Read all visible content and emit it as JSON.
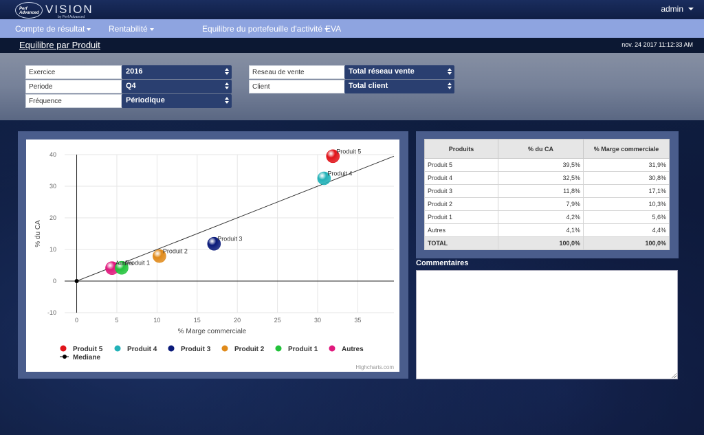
{
  "header": {
    "logo_small": "Perf Advanced",
    "logo_name": "VISION",
    "logo_by": "by Perf Advanced",
    "user": "admin"
  },
  "nav": {
    "items": [
      {
        "label": "Compte de résultat"
      },
      {
        "label": "Rentabilité"
      },
      {
        "label": "Equilibre du portefeuille d'activité"
      },
      {
        "label": "EVA"
      }
    ]
  },
  "page": {
    "title": "Equilibre par Produit",
    "timestamp": "nov. 24 2017 11:12:33 AM"
  },
  "filters": {
    "exercice": {
      "label": "Exercice",
      "value": "2016"
    },
    "periode": {
      "label": "Periode",
      "value": "Q4"
    },
    "frequence": {
      "label": "Fréquence",
      "value": "Périodique"
    },
    "reseau": {
      "label": "Reseau de vente",
      "value": "Total réseau vente"
    },
    "client": {
      "label": "Client",
      "value": "Total client"
    }
  },
  "chart_data": {
    "type": "scatter",
    "xlabel": "% Marge commerciale",
    "ylabel": "% du CA",
    "xlim": [
      -1.5,
      39.5
    ],
    "ylim": [
      -10,
      40
    ],
    "xticks": [
      0,
      5,
      10,
      15,
      20,
      25,
      30,
      35
    ],
    "yticks": [
      -10,
      0,
      10,
      20,
      30,
      40
    ],
    "credit": "Highcharts.com",
    "series": [
      {
        "name": "Produit 5",
        "x": 31.9,
        "y": 39.5,
        "color": "#e0141a"
      },
      {
        "name": "Produit 4",
        "x": 30.8,
        "y": 32.5,
        "color": "#23b2b8"
      },
      {
        "name": "Produit 3",
        "x": 17.1,
        "y": 11.8,
        "color": "#0a1a7a"
      },
      {
        "name": "Produit 2",
        "x": 10.3,
        "y": 7.9,
        "color": "#e08a1a"
      },
      {
        "name": "Produit 1",
        "x": 5.6,
        "y": 4.2,
        "color": "#22c23a"
      },
      {
        "name": "Autres",
        "x": 4.4,
        "y": 4.1,
        "color": "#e0197d"
      }
    ],
    "mediane": {
      "name": "Mediane",
      "points": [
        [
          0,
          0
        ],
        [
          39.5,
          39.5
        ]
      ],
      "color": "#000000"
    },
    "legend_position": "bottom-left"
  },
  "table": {
    "headers": [
      "Produits",
      "% du CA",
      "% Marge commerciale"
    ],
    "rows": [
      [
        "Produit 5",
        "39,5%",
        "31,9%"
      ],
      [
        "Produit 4",
        "32,5%",
        "30,8%"
      ],
      [
        "Produit 3",
        "11,8%",
        "17,1%"
      ],
      [
        "Produit 2",
        "7,9%",
        "10,3%"
      ],
      [
        "Produit 1",
        "4,2%",
        "5,6%"
      ],
      [
        "Autres",
        "4,1%",
        "4,4%"
      ]
    ],
    "total": [
      "TOTAL",
      "100,0%",
      "100,0%"
    ]
  },
  "comments": {
    "title": "Commentaires",
    "value": ""
  }
}
